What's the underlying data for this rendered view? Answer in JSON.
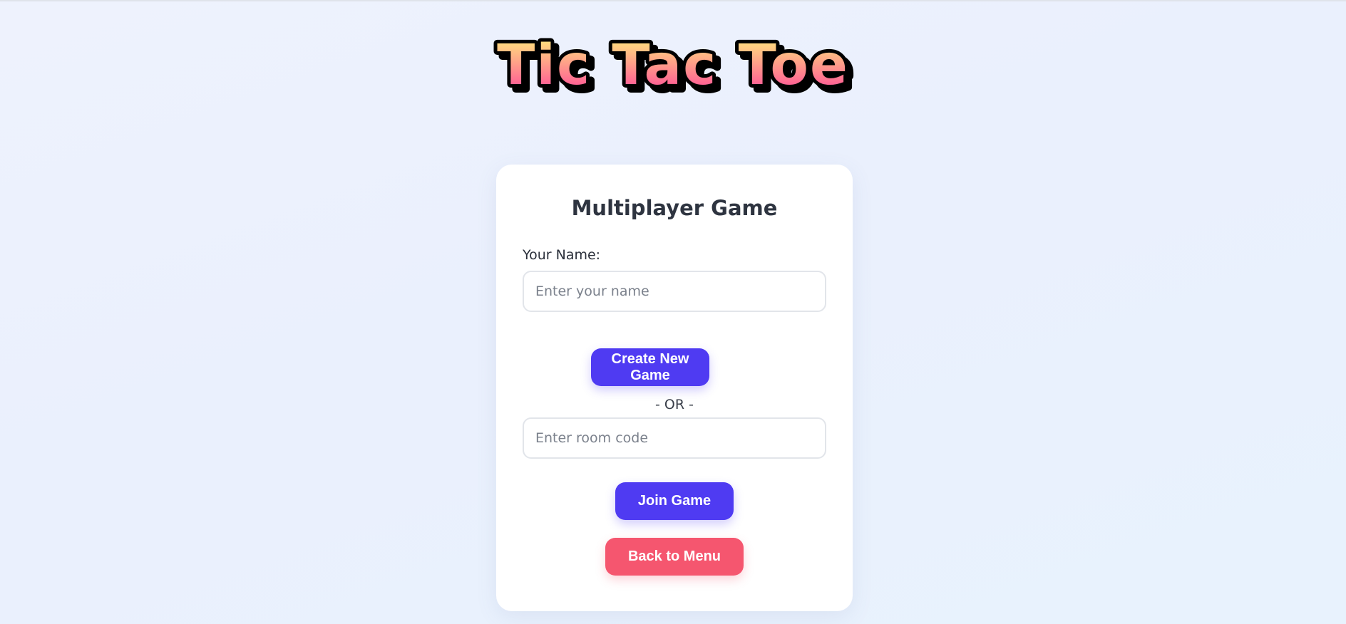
{
  "header": {
    "title": "Tic Tac Toe"
  },
  "colors": {
    "title_gradient_top": "#fff27a",
    "title_gradient_bottom": "#ff3f9a",
    "primary_button": "#4f3bf2",
    "back_button": "#f5566f",
    "card_background": "#ffffff"
  },
  "card": {
    "title": "Multiplayer Game",
    "name_label": "Your Name:",
    "name_input": {
      "value": "",
      "placeholder": "Enter your name"
    },
    "create_button": "Create New Game",
    "or_divider": "- OR -",
    "room_input": {
      "value": "",
      "placeholder": "Enter room code"
    },
    "join_button": "Join Game",
    "back_button": "Back to Menu"
  }
}
